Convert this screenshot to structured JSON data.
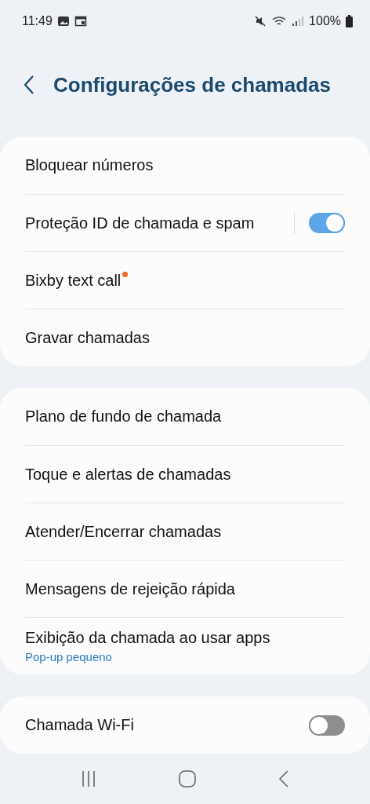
{
  "status_bar": {
    "time": "11:49",
    "battery": "100%"
  },
  "header": {
    "title": "Configurações de chamadas"
  },
  "groups": [
    {
      "items": [
        {
          "kind": "row",
          "label": "Bloquear números",
          "badge": false
        },
        {
          "kind": "toggle",
          "label": "Proteção ID de chamada e spam",
          "on": true,
          "badge": false
        },
        {
          "kind": "row",
          "label": "Bixby text call",
          "badge": true
        },
        {
          "kind": "row",
          "label": "Gravar chamadas",
          "badge": false
        }
      ]
    },
    {
      "items": [
        {
          "kind": "row",
          "label": "Plano de fundo de chamada",
          "badge": false
        },
        {
          "kind": "row",
          "label": "Toque e alertas de chamadas",
          "badge": false
        },
        {
          "kind": "row",
          "label": "Atender/Encerrar chamadas",
          "badge": false
        },
        {
          "kind": "row",
          "label": "Mensagens de rejeição rápida",
          "badge": false
        },
        {
          "kind": "row",
          "label": "Exibição da chamada ao usar apps",
          "subtitle": "Pop-up pequeno",
          "badge": false
        }
      ]
    },
    {
      "items": [
        {
          "kind": "toggle",
          "label": "Chamada Wi-Fi",
          "on": false,
          "badge": false
        }
      ]
    }
  ]
}
